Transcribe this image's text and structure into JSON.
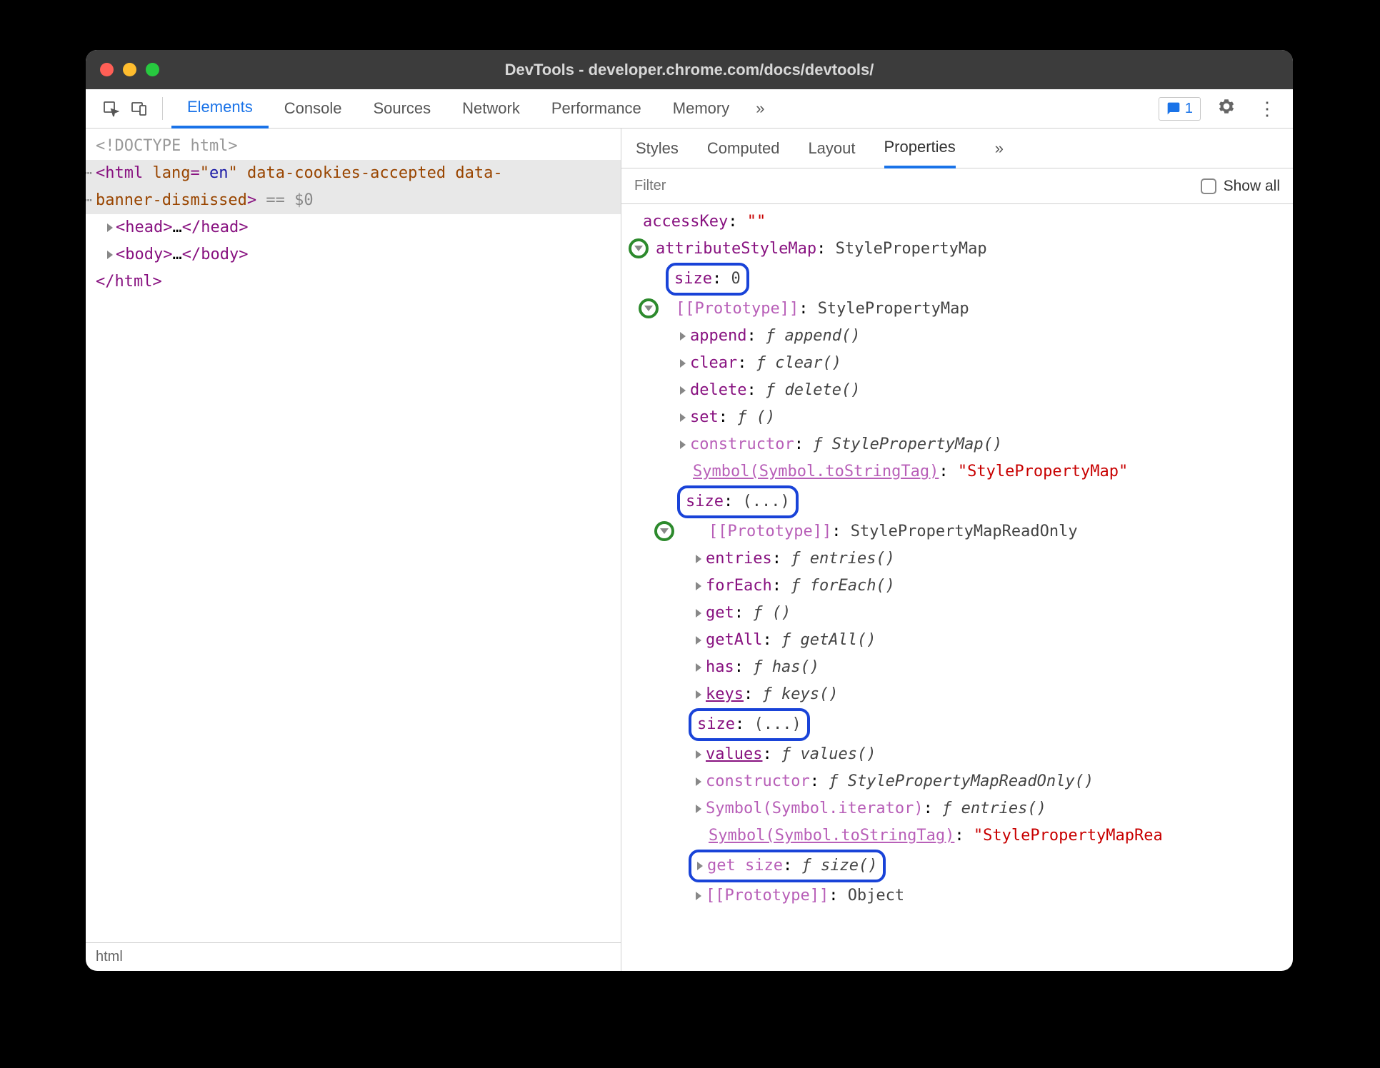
{
  "window": {
    "title": "DevTools - developer.chrome.com/docs/devtools/"
  },
  "toolbar": {
    "tabs": [
      "Elements",
      "Console",
      "Sources",
      "Network",
      "Performance",
      "Memory"
    ],
    "active_tab_index": 0,
    "issues_count": "1"
  },
  "dom": {
    "doctype": "<!DOCTYPE html>",
    "html_open": "<html lang=\"en\" data-cookies-accepted data-banner-dismissed>",
    "eq0": " == $0",
    "head": "<head>…</head>",
    "body": "<body>…</body>",
    "html_close": "</html>"
  },
  "breadcrumb": "html",
  "sidebar": {
    "tabs": [
      "Styles",
      "Computed",
      "Layout",
      "Properties"
    ],
    "active_index": 3,
    "filter_placeholder": "Filter",
    "show_all_label": "Show all"
  },
  "props": [
    {
      "ind": 20,
      "t": "kv",
      "key": "accessKey",
      "val": "\"\"",
      "valcls": "val-str"
    },
    {
      "ind": 20,
      "t": "down-green",
      "key": "attributeStyleMap",
      "val": "StylePropertyMap",
      "gx": 0
    },
    {
      "ind": 56,
      "t": "bluebox",
      "inner_key": "size",
      "inner_val": "0"
    },
    {
      "ind": 34,
      "t": "down-green",
      "key": "[[Prototype]]",
      "keycls": "keydim",
      "val": "StylePropertyMap",
      "gx": 14
    },
    {
      "ind": 72,
      "t": "tri",
      "key": "append",
      "fn": "append()"
    },
    {
      "ind": 72,
      "t": "tri",
      "key": "clear",
      "fn": "clear()"
    },
    {
      "ind": 72,
      "t": "tri",
      "key": "delete",
      "fn": "delete()"
    },
    {
      "ind": 72,
      "t": "tri",
      "key": "set",
      "fn": "()"
    },
    {
      "ind": 72,
      "t": "tri",
      "key": "constructor",
      "keycls": "keydim",
      "fn": "StylePropertyMap()"
    },
    {
      "ind": 90,
      "t": "kv",
      "key": "Symbol(Symbol.toStringTag)",
      "keycls": "keydim",
      "val": "\"StylePropertyMap\"",
      "valcls": "val-str",
      "underline": true
    },
    {
      "ind": 72,
      "t": "bluebox",
      "inner_key": "size",
      "inner_val": "(...)"
    },
    {
      "ind": 58,
      "t": "down-green",
      "key": "[[Prototype]]",
      "keycls": "keydim",
      "val": "StylePropertyMapReadOnly",
      "gx": 36
    },
    {
      "ind": 94,
      "t": "tri",
      "key": "entries",
      "fn": "entries()"
    },
    {
      "ind": 94,
      "t": "tri",
      "key": "forEach",
      "fn": "forEach()"
    },
    {
      "ind": 94,
      "t": "tri",
      "key": "get",
      "fn": "()"
    },
    {
      "ind": 94,
      "t": "tri",
      "key": "getAll",
      "fn": "getAll()"
    },
    {
      "ind": 94,
      "t": "tri",
      "key": "has",
      "fn": "has()"
    },
    {
      "ind": 94,
      "t": "tri",
      "key": "keys",
      "fn": "keys()",
      "underline": true
    },
    {
      "ind": 88,
      "t": "bluebox",
      "inner_key": "size",
      "inner_val": "(...)"
    },
    {
      "ind": 94,
      "t": "tri",
      "key": "values",
      "fn": "values()",
      "underline": true
    },
    {
      "ind": 94,
      "t": "tri",
      "key": "constructor",
      "keycls": "keydim",
      "fn": "StylePropertyMapReadOnly()"
    },
    {
      "ind": 94,
      "t": "tri",
      "key": "Symbol(Symbol.iterator)",
      "keycls": "keydim",
      "fn": "entries()"
    },
    {
      "ind": 112,
      "t": "kv",
      "key": "Symbol(Symbol.toStringTag)",
      "keycls": "keydim",
      "val": "\"StylePropertyMapRea",
      "valcls": "val-str",
      "underline": true
    },
    {
      "ind": 88,
      "t": "bluebox-tri",
      "inner_key": "get size",
      "inner_fn": "size()"
    },
    {
      "ind": 94,
      "t": "tri",
      "key": "[[Prototype]]",
      "keycls": "keydim",
      "val": "Object"
    }
  ]
}
